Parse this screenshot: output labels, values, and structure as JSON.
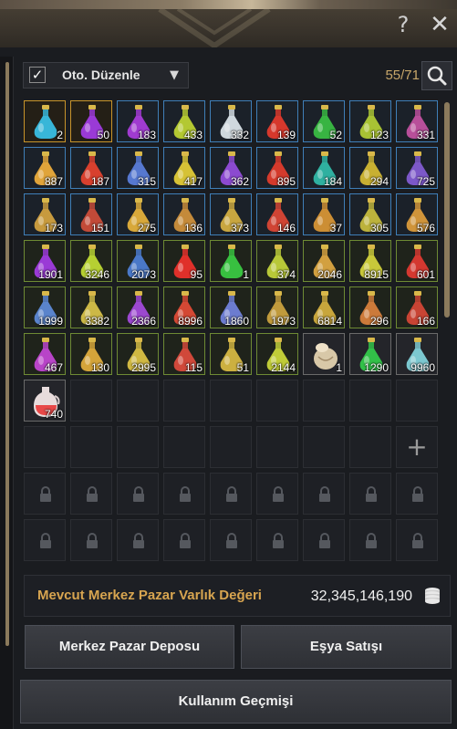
{
  "window": {
    "help_icon": "question-mark-icon",
    "close_icon": "close-icon"
  },
  "toolbar": {
    "auto_arrange_checked": true,
    "auto_arrange_label": "Oto. Düzenle",
    "slot_count": "55/71",
    "search_icon": "search-icon"
  },
  "inventory": {
    "rows": [
      [
        {
          "frame": "gold",
          "color": "#38b6d8",
          "count": "2"
        },
        {
          "frame": "gold",
          "color": "#9a3ad6",
          "count": "50"
        },
        {
          "frame": "blue",
          "color": "#a03bd0",
          "count": "183"
        },
        {
          "frame": "blue",
          "color": "#b3c832",
          "count": "433"
        },
        {
          "frame": "blue",
          "color": "#cfd8de",
          "count": "332"
        },
        {
          "frame": "blue",
          "color": "#d6382c",
          "count": "139"
        },
        {
          "frame": "blue",
          "color": "#38b442",
          "count": "52"
        },
        {
          "frame": "blue",
          "color": "#a8c234",
          "count": "123"
        },
        {
          "frame": "blue",
          "color": "#b84f9a",
          "count": "331"
        }
      ],
      [
        {
          "frame": "blue",
          "color": "#e0a43a",
          "count": "887"
        },
        {
          "frame": "blue",
          "color": "#d8402e",
          "count": "187"
        },
        {
          "frame": "blue",
          "color": "#5678d0",
          "count": "315"
        },
        {
          "frame": "blue",
          "color": "#d6c236",
          "count": "417"
        },
        {
          "frame": "blue",
          "color": "#8c4ad0",
          "count": "362"
        },
        {
          "frame": "blue",
          "color": "#d43a2c",
          "count": "895"
        },
        {
          "frame": "blue",
          "color": "#2fb0a0",
          "count": "184"
        },
        {
          "frame": "blue",
          "color": "#c8b032",
          "count": "294"
        },
        {
          "frame": "blue",
          "color": "#7c58c8",
          "count": "725"
        }
      ],
      [
        {
          "frame": "blue",
          "color": "#c79a3e",
          "count": "173"
        },
        {
          "frame": "blue",
          "color": "#c24a38",
          "count": "151"
        },
        {
          "frame": "blue",
          "color": "#d8a83a",
          "count": "275"
        },
        {
          "frame": "blue",
          "color": "#c48a3a",
          "count": "136"
        },
        {
          "frame": "blue",
          "color": "#c8a640",
          "count": "373"
        },
        {
          "frame": "blue",
          "color": "#d04434",
          "count": "146"
        },
        {
          "frame": "blue",
          "color": "#cc8e34",
          "count": "37"
        },
        {
          "frame": "blue",
          "color": "#bcb23c",
          "count": "305"
        },
        {
          "frame": "blue",
          "color": "#d0943a",
          "count": "576"
        }
      ],
      [
        {
          "frame": "green",
          "color": "#9a3ad6",
          "count": "1901"
        },
        {
          "frame": "green",
          "color": "#b6d032",
          "count": "3246"
        },
        {
          "frame": "green",
          "color": "#4a78c8",
          "count": "2073"
        },
        {
          "frame": "green",
          "color": "#e0302a",
          "count": "95"
        },
        {
          "frame": "green",
          "color": "#38c040",
          "count": "1"
        },
        {
          "frame": "green",
          "color": "#b8c838",
          "count": "374"
        },
        {
          "frame": "green",
          "color": "#d2a040",
          "count": "2046"
        },
        {
          "frame": "green",
          "color": "#c8c83a",
          "count": "8915"
        },
        {
          "frame": "green",
          "color": "#d43830",
          "count": "601"
        }
      ],
      [
        {
          "frame": "green",
          "color": "#5a84cc",
          "count": "1999"
        },
        {
          "frame": "green",
          "color": "#ccb846",
          "count": "3382"
        },
        {
          "frame": "green",
          "color": "#9c48d0",
          "count": "2366"
        },
        {
          "frame": "green",
          "color": "#d44834",
          "count": "8996"
        },
        {
          "frame": "green",
          "color": "#6c7cd0",
          "count": "1860"
        },
        {
          "frame": "green",
          "color": "#c09a3c",
          "count": "1973"
        },
        {
          "frame": "green",
          "color": "#c8a63c",
          "count": "6814"
        },
        {
          "frame": "green",
          "color": "#cc7a3a",
          "count": "296"
        },
        {
          "frame": "green",
          "color": "#c84434",
          "count": "166"
        }
      ],
      [
        {
          "frame": "green",
          "color": "#b844c8",
          "count": "467"
        },
        {
          "frame": "green",
          "color": "#d4a43a",
          "count": "130"
        },
        {
          "frame": "green",
          "color": "#d0b842",
          "count": "2995"
        },
        {
          "frame": "green",
          "color": "#d0483a",
          "count": "115"
        },
        {
          "frame": "green",
          "color": "#ccb040",
          "count": "51"
        },
        {
          "frame": "green",
          "color": "#c0cc38",
          "count": "2144"
        },
        {
          "frame": "grey",
          "color": "#d8c8a8",
          "count": "1",
          "icon": "flour-sack-icon"
        },
        {
          "frame": "grey",
          "color": "#32c048",
          "count": "1290"
        },
        {
          "frame": "grey",
          "color": "#7cc8d0",
          "count": "9960"
        }
      ],
      [
        {
          "frame": "grey",
          "color": "#e84848",
          "count": "740",
          "icon": "jug-icon"
        },
        {
          "frame": "empty"
        },
        {
          "frame": "empty"
        },
        {
          "frame": "empty"
        },
        {
          "frame": "empty"
        },
        {
          "frame": "empty"
        },
        {
          "frame": "empty"
        },
        {
          "frame": "empty"
        },
        {
          "frame": "empty"
        }
      ],
      [
        {
          "frame": "empty"
        },
        {
          "frame": "empty"
        },
        {
          "frame": "empty"
        },
        {
          "frame": "empty"
        },
        {
          "frame": "empty"
        },
        {
          "frame": "empty"
        },
        {
          "frame": "empty"
        },
        {
          "frame": "empty"
        },
        {
          "frame": "add"
        }
      ],
      [
        {
          "frame": "locked"
        },
        {
          "frame": "locked"
        },
        {
          "frame": "locked"
        },
        {
          "frame": "locked"
        },
        {
          "frame": "locked"
        },
        {
          "frame": "locked"
        },
        {
          "frame": "locked"
        },
        {
          "frame": "locked"
        },
        {
          "frame": "locked"
        }
      ],
      [
        {
          "frame": "locked"
        },
        {
          "frame": "locked"
        },
        {
          "frame": "locked"
        },
        {
          "frame": "locked"
        },
        {
          "frame": "locked"
        },
        {
          "frame": "locked"
        },
        {
          "frame": "locked"
        },
        {
          "frame": "locked"
        },
        {
          "frame": "locked"
        }
      ]
    ]
  },
  "asset": {
    "label": "Mevcut Merkez Pazar Varlık Değeri",
    "value": "32,345,146,190",
    "icon": "silver-coins-icon"
  },
  "buttons": {
    "deposit": "Merkez Pazar Deposu",
    "sell": "Eşya Satışı",
    "history": "Kullanım Geçmişi"
  }
}
